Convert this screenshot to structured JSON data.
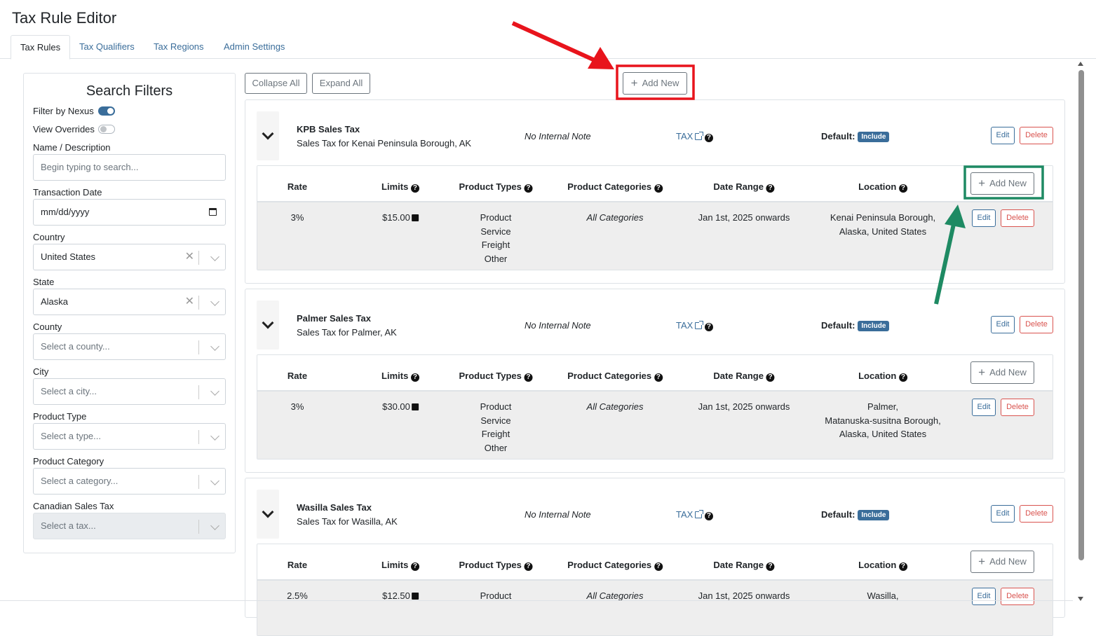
{
  "app": {
    "title": "Tax Rule Editor"
  },
  "tabs": [
    {
      "label": "Tax Rules",
      "active": true
    },
    {
      "label": "Tax Qualifiers"
    },
    {
      "label": "Tax Regions"
    },
    {
      "label": "Admin Settings"
    }
  ],
  "filters": {
    "title": "Search Filters",
    "filter_by_nexus": {
      "label": "Filter by Nexus",
      "on": true
    },
    "view_overrides": {
      "label": "View Overrides",
      "on": false
    },
    "name_label": "Name / Description",
    "name_placeholder": "Begin typing to search...",
    "date_label": "Transaction Date",
    "date_placeholder": "mm/dd/yyyy",
    "country_label": "Country",
    "country_value": "United States",
    "state_label": "State",
    "state_value": "Alaska",
    "county_label": "County",
    "county_placeholder": "Select a county...",
    "city_label": "City",
    "city_placeholder": "Select a city...",
    "product_type_label": "Product Type",
    "product_type_placeholder": "Select a type...",
    "product_category_label": "Product Category",
    "product_category_placeholder": "Select a category...",
    "canadian_label": "Canadian Sales Tax",
    "canadian_placeholder": "Select a tax..."
  },
  "toolbar": {
    "collapse_all": "Collapse All",
    "expand_all": "Expand All",
    "add_new": "Add New"
  },
  "common": {
    "edit": "Edit",
    "delete": "Delete",
    "add_new": "Add New",
    "no_note": "No Internal Note",
    "tax_link": "TAX",
    "default_label": "Default",
    "default_colon": ":",
    "include_badge": "Include",
    "help_glyph": "?",
    "col_rate": "Rate",
    "col_limits": "Limits",
    "col_product_types": "Product Types",
    "col_product_categories": "Product Categories",
    "col_date_range": "Date Range",
    "col_location": "Location"
  },
  "rules": [
    {
      "name": "KPB Sales Tax",
      "description": "Sales Tax for Kenai Peninsula Borough, AK",
      "rate": "3%",
      "limit": "$15.00",
      "product_types": [
        "Product",
        "Service",
        "Freight",
        "Other"
      ],
      "categories": "All Categories",
      "date_range": "Jan 1st, 2025 onwards",
      "location": [
        "Kenai Peninsula Borough,",
        "Alaska, United States"
      ]
    },
    {
      "name": "Palmer Sales Tax",
      "description": "Sales Tax for Palmer, AK",
      "rate": "3%",
      "limit": "$30.00",
      "product_types": [
        "Product",
        "Service",
        "Freight",
        "Other"
      ],
      "categories": "All Categories",
      "date_range": "Jan 1st, 2025 onwards",
      "location": [
        "Palmer,",
        "Matanuska-susitna Borough,",
        "Alaska, United States"
      ]
    },
    {
      "name": "Wasilla Sales Tax",
      "description": "Sales Tax for Wasilla, AK",
      "rate": "2.5%",
      "limit": "$12.50",
      "product_types": [
        "Product"
      ],
      "categories": "All Categories",
      "date_range": "Jan 1st, 2025 onwards",
      "location": [
        "Wasilla,"
      ]
    }
  ],
  "annotations": {
    "red_color": "#e8141c",
    "green_color": "#1e8a63"
  }
}
